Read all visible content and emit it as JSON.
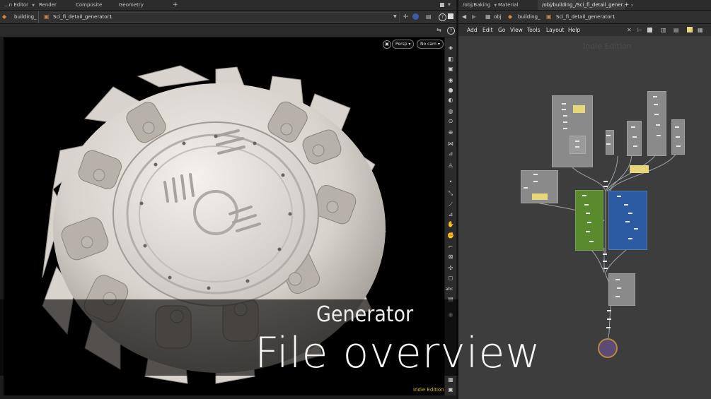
{
  "left_tabs": [
    {
      "label": "...n Editor"
    },
    {
      "label": "Render View"
    },
    {
      "label": "Composite View"
    },
    {
      "label": "Geometry Spreadsheet"
    }
  ],
  "right_tabs": [
    {
      "label": "/obj/Baking"
    },
    {
      "label": "Material Palette"
    },
    {
      "label": "/obj/building_/Sci_fi_detail_gener..."
    }
  ],
  "left_path": {
    "crumb1": "building_",
    "crumb2": "Sci_fi_detail_generator1"
  },
  "right_path": {
    "crumb0": "obj",
    "crumb1": "building_",
    "crumb2": "Sci_fi_detail_generator1"
  },
  "viewport": {
    "persp_label": "Persp",
    "cam_label": "No cam",
    "status": "Indie Edition"
  },
  "network_menu": [
    "Add",
    "Edit",
    "Go",
    "View",
    "Tools",
    "Layout",
    "Help"
  ],
  "network": {
    "watermark": "Indie Edition"
  },
  "caption": {
    "subtitle": "Generator",
    "title": "File overview"
  },
  "colors": {
    "green_box": "#5a8a2e",
    "blue_box": "#2c5aa3",
    "sticky": "#e5d77a",
    "status_yellow": "#d8c200"
  }
}
